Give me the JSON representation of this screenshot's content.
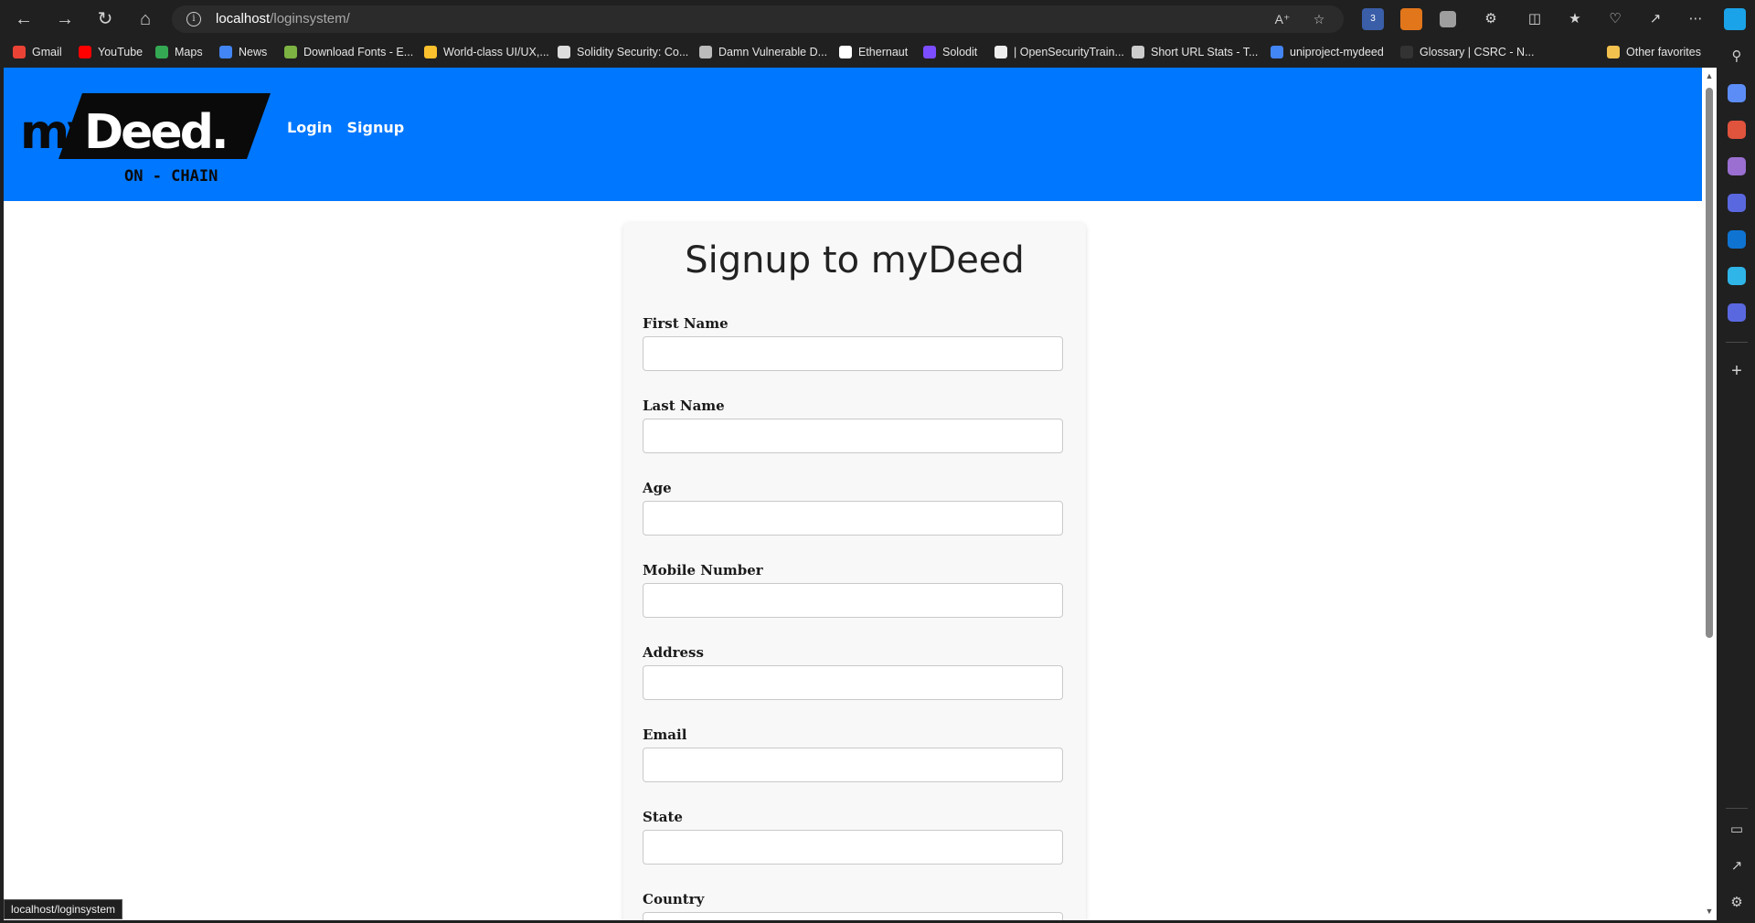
{
  "browser": {
    "url_host": "localhost",
    "url_path": "/loginsystem/",
    "bookmarks": [
      {
        "label": "Gmail",
        "color": "#ea4335"
      },
      {
        "label": "YouTube",
        "color": "#ff0000"
      },
      {
        "label": "Maps",
        "color": "#34a853"
      },
      {
        "label": "News",
        "color": "#4285f4"
      },
      {
        "label": "Download Fonts - E...",
        "color": "#7cb342"
      },
      {
        "label": "World-class UI/UX,...",
        "color": "#fbc02d"
      },
      {
        "label": "Solidity Security: Co...",
        "color": "#dddddd"
      },
      {
        "label": "Damn Vulnerable D...",
        "color": "#bbbbbb"
      },
      {
        "label": "Ethernaut",
        "color": "#ffffff"
      },
      {
        "label": "Solodit",
        "color": "#7c4dff"
      },
      {
        "label": "| OpenSecurityTrain...",
        "color": "#eeeeee"
      },
      {
        "label": "Short URL Stats - T...",
        "color": "#cccccc"
      },
      {
        "label": "uniproject-mydeed",
        "color": "#4285f4"
      },
      {
        "label": "Glossary | CSRC - N...",
        "color": "#333333"
      }
    ],
    "other_favorites": "Other favorites",
    "status_tip": "localhost/loginsystem"
  },
  "site": {
    "logo_main": "myDeed.",
    "logo_sub": "ON - CHAIN",
    "nav": {
      "login": "Login",
      "signup": "Signup"
    }
  },
  "form": {
    "title": "Signup to myDeed",
    "fields": [
      {
        "label": "First Name",
        "value": ""
      },
      {
        "label": "Last Name",
        "value": ""
      },
      {
        "label": "Age",
        "value": ""
      },
      {
        "label": "Mobile Number",
        "value": ""
      },
      {
        "label": "Address",
        "value": ""
      },
      {
        "label": "Email",
        "value": ""
      },
      {
        "label": "State",
        "value": ""
      },
      {
        "label": "Country",
        "value": ""
      }
    ]
  },
  "colors": {
    "header_blue": "#0077ff",
    "chrome_dark": "#202020"
  }
}
